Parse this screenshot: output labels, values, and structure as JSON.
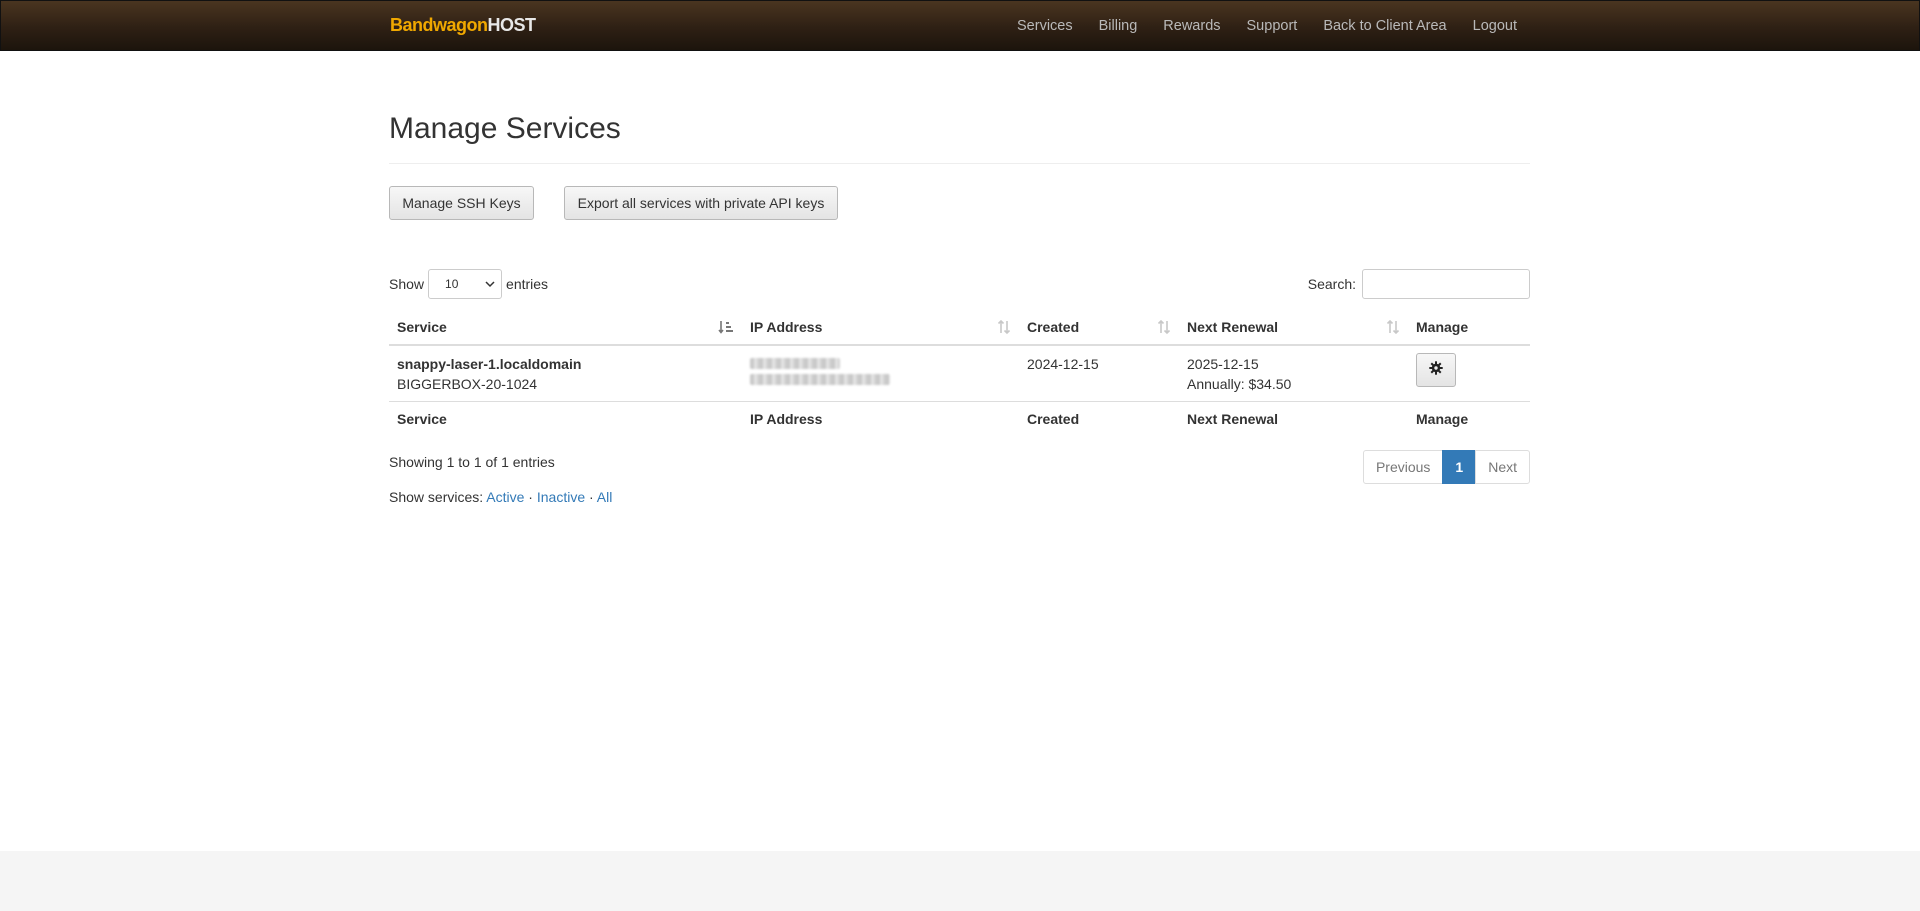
{
  "brand": {
    "part1": "Bandwagon",
    "part2": "HOST"
  },
  "nav": {
    "items": [
      "Services",
      "Billing",
      "Rewards",
      "Support",
      "Back to Client Area",
      "Logout"
    ]
  },
  "page": {
    "title": "Manage Services"
  },
  "actions": {
    "manage_ssh_keys": "Manage SSH Keys",
    "export_services": "Export all services with private API keys"
  },
  "table_controls": {
    "show_label": "Show",
    "entries_label": "entries",
    "page_length": "10",
    "search_label": "Search:",
    "search_value": ""
  },
  "table": {
    "columns": [
      "Service",
      "IP Address",
      "Created",
      "Next Renewal",
      "Manage"
    ],
    "sorted_column": "Service",
    "rows": [
      {
        "hostname": "snappy-laser-1.localdomain",
        "plan": "BIGGERBOX-20-1024",
        "ip_note": "blurred",
        "created": "2024-12-15",
        "next_renewal": "2025-12-15",
        "billing": "Annually: $34.50",
        "manage_icon": "gear-icon"
      }
    ]
  },
  "info": {
    "text": "Showing 1 to 1 of 1 entries"
  },
  "pagination": {
    "previous": "Previous",
    "current": "1",
    "next": "Next"
  },
  "filters": {
    "label": "Show services:",
    "active": "Active",
    "inactive": "Inactive",
    "all": "All",
    "separator": "·"
  },
  "colors": {
    "navbar_top": "#4a3520",
    "navbar_bottom": "#1c140c",
    "brand_accent": "#f0a800",
    "link": "#337ab7",
    "footer_bg": "#f5f5f5"
  }
}
